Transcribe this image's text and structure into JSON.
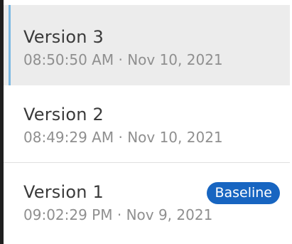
{
  "versions": [
    {
      "title": "Version 3",
      "timestamp": "08:50:50 AM · Nov 10, 2021",
      "selected": true
    },
    {
      "title": "Version 2",
      "timestamp": "08:49:29 AM · Nov 10, 2021",
      "selected": false
    },
    {
      "title": "Version 1",
      "timestamp": "09:02:29 PM · Nov 9, 2021",
      "selected": false,
      "badge": "Baseline"
    }
  ],
  "colors": {
    "accent": "#7ab8e3",
    "badge": "#1765c1",
    "selected_bg": "#ececec"
  }
}
